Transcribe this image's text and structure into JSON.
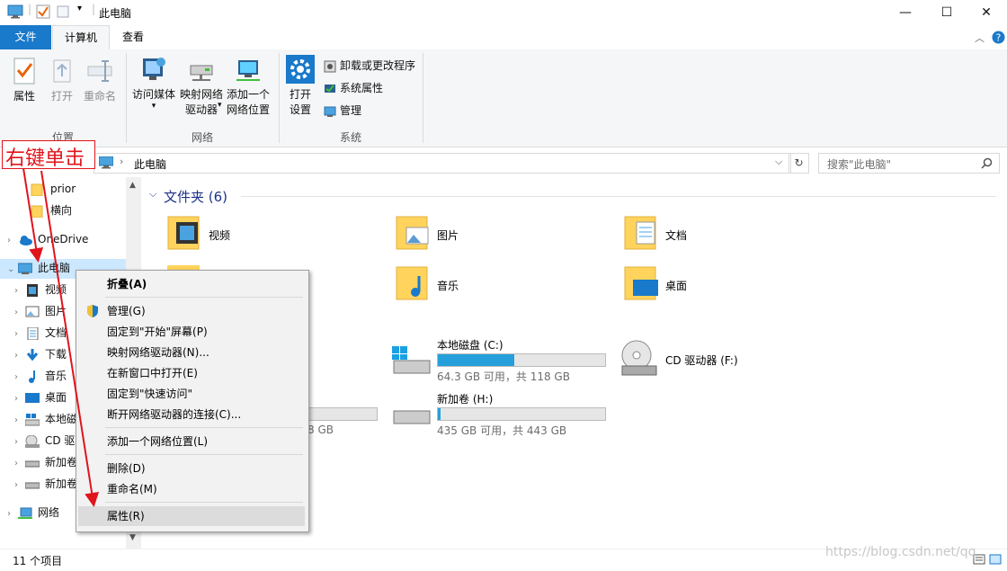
{
  "window": {
    "title": "此电脑",
    "minimize": "—",
    "maximize": "☐",
    "close": "✕"
  },
  "ribbon_tabs": {
    "file": "文件",
    "computer": "计算机",
    "view": "查看"
  },
  "ribbon": {
    "location_group": {
      "label": "位置",
      "properties": "属性",
      "open": "打开",
      "rename": "重命名"
    },
    "network_group": {
      "label": "网络",
      "access_media": "访问媒体",
      "map_drive_l1": "映射网络",
      "map_drive_l2": "驱动器",
      "add_location_l1": "添加一个",
      "add_location_l2": "网络位置"
    },
    "system_group": {
      "label": "系统",
      "open_settings_l1": "打开",
      "open_settings_l2": "设置",
      "uninstall": "卸载或更改程序",
      "system_props": "系统属性",
      "manage": "管理"
    }
  },
  "address": {
    "crumb": "此电脑",
    "search_placeholder": "搜索\"此电脑\""
  },
  "nav": {
    "items": [
      {
        "label": "prior"
      },
      {
        "label": "横向"
      },
      {
        "label": "OneDrive"
      },
      {
        "label": "此电脑"
      },
      {
        "label": "视频"
      },
      {
        "label": "图片"
      },
      {
        "label": "文档"
      },
      {
        "label": "下载"
      },
      {
        "label": "音乐"
      },
      {
        "label": "桌面"
      },
      {
        "label": "本地磁"
      },
      {
        "label": "CD 驱"
      },
      {
        "label": "新加卷"
      },
      {
        "label": "新加卷"
      },
      {
        "label": "网络"
      }
    ]
  },
  "content": {
    "folders_header": "文件夹 (6)",
    "folders": [
      {
        "name": "视频"
      },
      {
        "name": "图片"
      },
      {
        "name": "文档"
      },
      {
        "name": "音乐"
      },
      {
        "name": "桌面"
      }
    ],
    "drives": [
      {
        "name": "本地磁盘 (C:)",
        "info": "64.3 GB 可用，共 118 GB",
        "used_fraction": 0.455
      },
      {
        "name": "CD 驱动器 (F:)"
      },
      {
        "name": "新加卷 (H:)",
        "info": "435 GB 可用，共 443 GB",
        "used_fraction": 0.018
      }
    ],
    "partial_left_info": "8 GB"
  },
  "context_menu": {
    "collapse": "折叠(A)",
    "manage": "管理(G)",
    "pin_start": "固定到\"开始\"屏幕(P)",
    "map_drive": "映射网络驱动器(N)...",
    "open_new_window": "在新窗口中打开(E)",
    "pin_quick": "固定到\"快速访问\"",
    "disconnect": "断开网络驱动器的连接(C)...",
    "add_location": "添加一个网络位置(L)",
    "delete": "删除(D)",
    "rename": "重命名(M)",
    "properties": "属性(R)"
  },
  "status": {
    "items": "11 个项目"
  },
  "annotation": {
    "text": "右键单击"
  },
  "watermark": "https://blog.csdn.net/qq"
}
